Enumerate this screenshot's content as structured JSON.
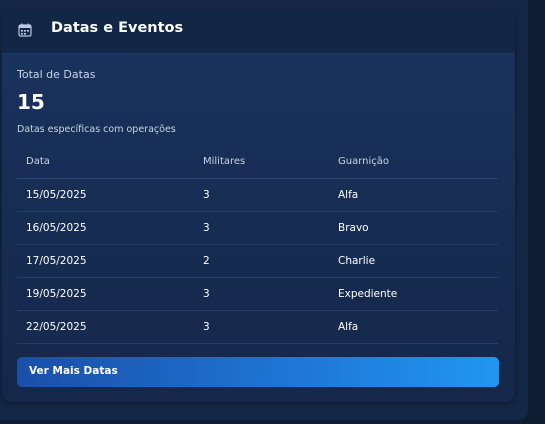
{
  "card": {
    "title": "Datas e Eventos",
    "icon": "calendar-icon",
    "accent": "#2196f0"
  },
  "summary": {
    "label": "Total de Datas",
    "value": "15",
    "description": "Datas específicas com operações"
  },
  "table": {
    "headers": [
      "Data",
      "Militares",
      "Guarnição"
    ],
    "rows": [
      [
        "15/05/2025",
        "3",
        "Alfa"
      ],
      [
        "16/05/2025",
        "3",
        "Bravo"
      ],
      [
        "17/05/2025",
        "2",
        "Charlie"
      ],
      [
        "19/05/2025",
        "3",
        "Expediente"
      ],
      [
        "22/05/2025",
        "3",
        "Alfa"
      ]
    ]
  },
  "button": {
    "label": "Ver Mais Datas"
  }
}
